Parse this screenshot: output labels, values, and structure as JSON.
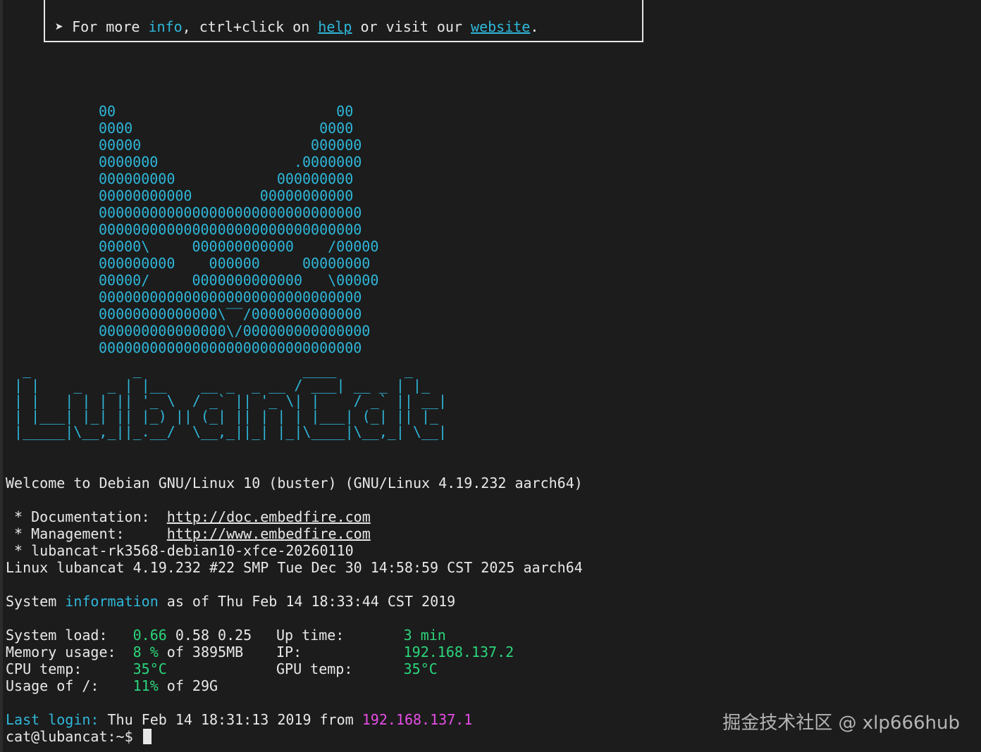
{
  "info_box": {
    "arrow": "➤",
    "prefix": " For more ",
    "info_word": "info",
    "middle": ", ctrl+click on ",
    "help_link": "help",
    "or_visit": " or visit our ",
    "website_link": "website",
    "end": "."
  },
  "ascii_art": {
    "lines": [
      "00                          00",
      "0000                      0000",
      "00000                    000000",
      "0000000                .0000000",
      "000000000            000000000",
      "00000000000        00000000000",
      "0000000000000000000000000000000",
      "0000000000000000000000000000000",
      "00000\\     000000000000    /00000",
      "000000000    000000     00000000",
      "00000/     0000000000000   \\00000",
      "0000000000000000000000000000000",
      "00000000000000\\‾‾/0000000000000",
      "000000000000000\\/000000000000000",
      "0000000000000000000000000000000"
    ]
  },
  "logo_ascii": {
    "lines": [
      " _            _                   ____        _   ",
      "| |    _   _ | |__    __ _  _ __ / ___| __ _ | |_ ",
      "| |   | | | || '_ \\  / _` || '_ \\| |    / _` || __|",
      "| |___| |_| || |_) || (_| || | | | |___| (_| || |_ ",
      "|_____|\\__,_||_.__/  \\__,_||_| |_|\\____|\\__,_| \\__|"
    ]
  },
  "welcome": "Welcome to Debian GNU/Linux 10 (buster) (GNU/Linux 4.19.232 aarch64)",
  "docs": {
    "doc_label": " * Documentation:  ",
    "doc_url": "http://doc.embedfire.com",
    "mgmt_label": " * Management:     ",
    "mgmt_url": "http://www.embedfire.com",
    "image_line": " * lubancat-rk3568-debian10-xfce-20260110"
  },
  "uname": "Linux lubancat 4.19.232 #22 SMP Tue Dec 30 14:58:59 CST 2025 aarch64",
  "sysinfo": {
    "prefix": "System ",
    "info_word": "information",
    "suffix": " as of Thu Feb 14 18:33:44 CST 2019"
  },
  "stats": {
    "load_label": "System load:   ",
    "load_first": "0.66",
    "load_rest": " 0.58 0.25",
    "uptime_label": "Up time:       ",
    "uptime_value": "3 min",
    "mem_label": "Memory usage:  ",
    "mem_value": "8 %",
    "mem_rest": " of 3895MB",
    "ip_label": "IP:            ",
    "ip_value": "192.168.137.2",
    "cpu_label": "CPU temp:      ",
    "cpu_value": "35°C",
    "gpu_label": "GPU temp:      ",
    "gpu_value": "35°C",
    "usage_label": "Usage of /:    ",
    "usage_value": "11%",
    "usage_rest": " of 29G"
  },
  "last_login": {
    "label": "Last login:",
    "text": " Thu Feb 14 18:31:13 2019 from ",
    "ip": "192.168.137.1"
  },
  "prompt": "cat@lubancat:~$ ",
  "watermark": "掘金技术社区 @ xlp666hub",
  "colors": {
    "background": "#1c1c1c",
    "foreground": "#e8e8e8",
    "cyan": "#2fb7d9",
    "green": "#2bd67b",
    "magenta": "#e64de6"
  }
}
